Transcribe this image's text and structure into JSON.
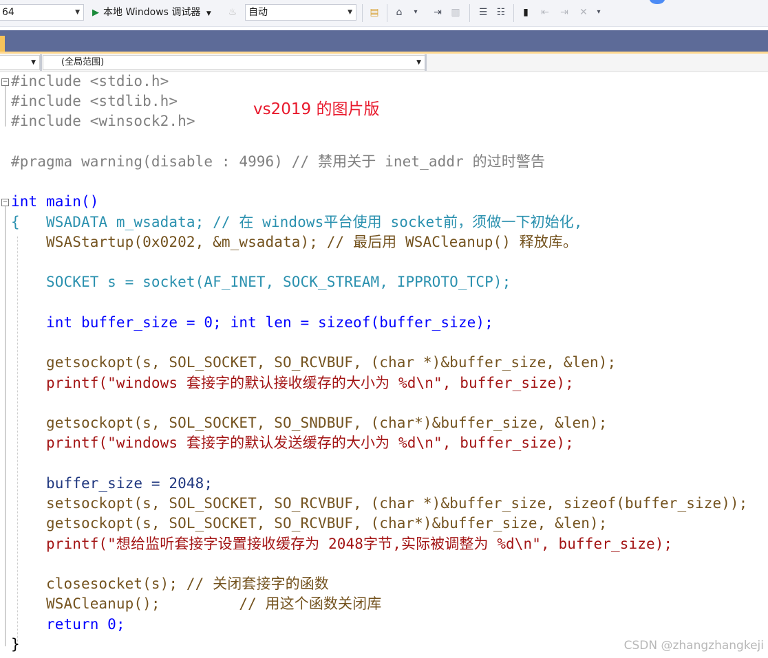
{
  "toolbar": {
    "platform_value": "64",
    "debugger_label": "本地 Windows 调试器",
    "mode_value": "自动"
  },
  "navbar": {
    "scope_value": "(全局范围)"
  },
  "overlay_note": "vs2019 的图片版",
  "watermark": "CSDN @zhangzhangkeji",
  "code": [
    {
      "text": "#include <stdio.h>",
      "fold": "minus"
    },
    {
      "text": "#include <stdlib.h>"
    },
    {
      "text": "#include <winsock2.h>"
    },
    {
      "text": ""
    },
    {
      "text": "#pragma warning(disable : 4996) // 禁用关于 inet_addr 的过时警告"
    },
    {
      "text": ""
    },
    {
      "text": "int main()",
      "fold": "minus"
    },
    {
      "text": "{   WSADATA m_wsadata; // 在 windows平台使用 socket前，须做一下初始化,"
    },
    {
      "text": "    WSAStartup(0x0202, &m_wsadata); // 最后用 WSACleanup() 释放库。"
    },
    {
      "text": ""
    },
    {
      "text": "    SOCKET s = socket(AF_INET, SOCK_STREAM, IPPROTO_TCP);"
    },
    {
      "text": ""
    },
    {
      "text": "    int buffer_size = 0; int len = sizeof(buffer_size);"
    },
    {
      "text": ""
    },
    {
      "text": "    getsockopt(s, SOL_SOCKET, SO_RCVBUF, (char *)&buffer_size, &len);"
    },
    {
      "text": "    printf(\"windows 套接字的默认接收缓存的大小为 %d\\n\", buffer_size);"
    },
    {
      "text": ""
    },
    {
      "text": "    getsockopt(s, SOL_SOCKET, SO_SNDBUF, (char*)&buffer_size, &len);"
    },
    {
      "text": "    printf(\"windows 套接字的默认发送缓存的大小为 %d\\n\", buffer_size);"
    },
    {
      "text": ""
    },
    {
      "text": "    buffer_size = 2048;"
    },
    {
      "text": "    setsockopt(s, SOL_SOCKET, SO_RCVBUF, (char *)&buffer_size, sizeof(buffer_size));"
    },
    {
      "text": "    getsockopt(s, SOL_SOCKET, SO_RCVBUF, (char*)&buffer_size, &len);"
    },
    {
      "text": "    printf(\"想给监听套接字设置接收缓存为 2048字节,实际被调整为 %d\\n\", buffer_size);"
    },
    {
      "text": ""
    },
    {
      "text": "    closesocket(s); // 关闭套接字的函数"
    },
    {
      "text": "    WSACleanup();         // 用这个函数关闭库"
    },
    {
      "text": "    return 0;"
    },
    {
      "text": "}"
    }
  ],
  "colors": {
    "keyword": "#0000ff",
    "preprocessor": "#808080",
    "string": "#a31515",
    "comment": "#008000",
    "type": "#2b91af",
    "function": "#74531f",
    "tab_strip": "#5d6b98",
    "note": "#e8192c"
  }
}
